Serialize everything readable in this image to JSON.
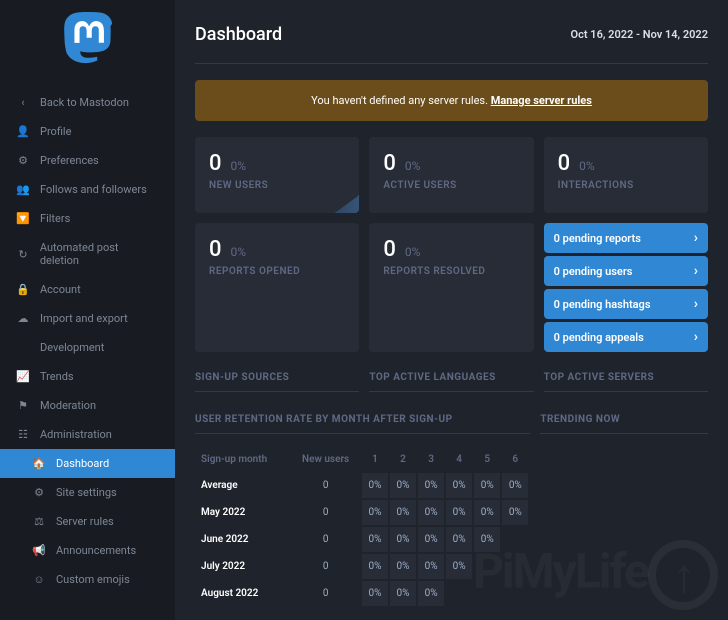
{
  "header": {
    "title": "Dashboard",
    "date_range": "Oct 16, 2022 - Nov 14, 2022"
  },
  "alert": {
    "text": "You haven't defined any server rules. ",
    "link": "Manage server rules"
  },
  "sidebar": {
    "back": "Back to Mastodon",
    "items": [
      {
        "icon": "user",
        "label": "Profile"
      },
      {
        "icon": "cog",
        "label": "Preferences"
      },
      {
        "icon": "users",
        "label": "Follows and followers"
      },
      {
        "icon": "filter",
        "label": "Filters"
      },
      {
        "icon": "history",
        "label": "Automated post deletion"
      },
      {
        "icon": "lock",
        "label": "Account"
      },
      {
        "icon": "cloud",
        "label": "Import and export"
      },
      {
        "icon": "code",
        "label": "Development"
      },
      {
        "icon": "chart",
        "label": "Trends"
      },
      {
        "icon": "flag",
        "label": "Moderation"
      },
      {
        "icon": "sliders",
        "label": "Administration"
      }
    ],
    "sub_items": [
      {
        "icon": "tach",
        "label": "Dashboard",
        "active": true
      },
      {
        "icon": "cogs",
        "label": "Site settings"
      },
      {
        "icon": "gavel",
        "label": "Server rules"
      },
      {
        "icon": "bullhorn",
        "label": "Announcements"
      },
      {
        "icon": "smile",
        "label": "Custom emojis"
      }
    ]
  },
  "stats": {
    "row1": [
      {
        "value": "0",
        "pct": "0%",
        "label": "NEW USERS",
        "spark": true
      },
      {
        "value": "0",
        "pct": "0%",
        "label": "ACTIVE USERS"
      },
      {
        "value": "0",
        "pct": "0%",
        "label": "INTERACTIONS"
      }
    ],
    "row2": [
      {
        "value": "0",
        "pct": "0%",
        "label": "REPORTS OPENED"
      },
      {
        "value": "0",
        "pct": "0%",
        "label": "REPORTS RESOLVED"
      }
    ]
  },
  "pending": [
    {
      "label": "0 pending reports"
    },
    {
      "label": "0 pending users"
    },
    {
      "label": "0 pending hashtags"
    },
    {
      "label": "0 pending appeals"
    }
  ],
  "sections": {
    "signup_sources": "SIGN-UP SOURCES",
    "top_languages": "TOP ACTIVE LANGUAGES",
    "top_servers": "TOP ACTIVE SERVERS",
    "retention_title": "USER RETENTION RATE BY MONTH AFTER SIGN-UP",
    "trending_now": "TRENDING NOW"
  },
  "retention": {
    "headers": [
      "Sign-up month",
      "New users",
      "1",
      "2",
      "3",
      "4",
      "5",
      "6"
    ],
    "rows": [
      {
        "label": "Average",
        "users": "0",
        "pcts": [
          "0%",
          "0%",
          "0%",
          "0%",
          "0%",
          "0%"
        ]
      },
      {
        "label": "May 2022",
        "users": "0",
        "pcts": [
          "0%",
          "0%",
          "0%",
          "0%",
          "0%",
          "0%"
        ]
      },
      {
        "label": "June 2022",
        "users": "0",
        "pcts": [
          "0%",
          "0%",
          "0%",
          "0%",
          "0%",
          ""
        ]
      },
      {
        "label": "July 2022",
        "users": "0",
        "pcts": [
          "0%",
          "0%",
          "0%",
          "0%",
          "",
          ""
        ]
      },
      {
        "label": "August 2022",
        "users": "0",
        "pcts": [
          "0%",
          "0%",
          "0%",
          "",
          "",
          ""
        ]
      }
    ]
  },
  "icons": {
    "arrow_left": "‹",
    "user": "👤",
    "cog": "⚙",
    "users": "👥",
    "filter": "🔽",
    "history": "↻",
    "lock": "🔒",
    "cloud": "☁",
    "code": "</>",
    "chart": "📈",
    "flag": "⚑",
    "sliders": "☷",
    "tach": "🏠",
    "cogs": "⚙",
    "gavel": "⚖",
    "bullhorn": "📢",
    "smile": "☺",
    "chevron_right": "›"
  }
}
